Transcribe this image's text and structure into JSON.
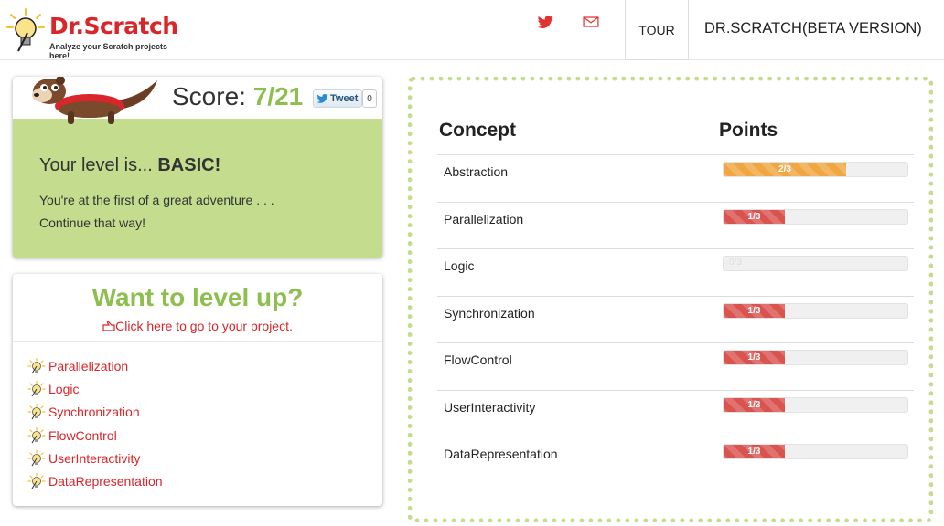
{
  "header": {
    "logo_title": "Dr.Scratch",
    "logo_subtitle": "Analyze your Scratch projects here!",
    "tour_label": "TOUR",
    "brand_label": "DR.SCRATCH(BETA VERSION)",
    "twitter_icon": "twitter-icon",
    "mail_icon": "mail-icon"
  },
  "score": {
    "label": "Score:",
    "value": "7/21",
    "tweet_label": "Tweet",
    "tweet_count": "0",
    "level_prefix": "Your level is...",
    "level_value": "BASIC!",
    "message_line1": "You're at the first of a great adventure . . .",
    "message_line2": "Continue that way!"
  },
  "levelup": {
    "title": "Want to level up?",
    "link_label": "Click here to go to your project.",
    "items": [
      "Parallelization",
      "Logic",
      "Synchronization",
      "FlowControl",
      "UserInteractivity",
      "DataRepresentation"
    ]
  },
  "table": {
    "col_concept": "Concept",
    "col_points": "Points",
    "rows": [
      {
        "name": "Abstraction",
        "points": "2/3",
        "value": 2,
        "max": 3,
        "color": "#f0a741"
      },
      {
        "name": "Parallelization",
        "points": "1/3",
        "value": 1,
        "max": 3,
        "color": "#d9534f"
      },
      {
        "name": "Logic",
        "points": "0/3",
        "value": 0,
        "max": 3,
        "color": "#d9534f"
      },
      {
        "name": "Synchronization",
        "points": "1/3",
        "value": 1,
        "max": 3,
        "color": "#d9534f"
      },
      {
        "name": "FlowControl",
        "points": "1/3",
        "value": 1,
        "max": 3,
        "color": "#d9534f"
      },
      {
        "name": "UserInteractivity",
        "points": "1/3",
        "value": 1,
        "max": 3,
        "color": "#d9534f"
      },
      {
        "name": "DataRepresentation",
        "points": "1/3",
        "value": 1,
        "max": 3,
        "color": "#d9534f"
      }
    ]
  },
  "colors": {
    "accent_green": "#8dbf4f",
    "panel_green": "#c4dc8e",
    "brand_red": "#d9262b"
  }
}
